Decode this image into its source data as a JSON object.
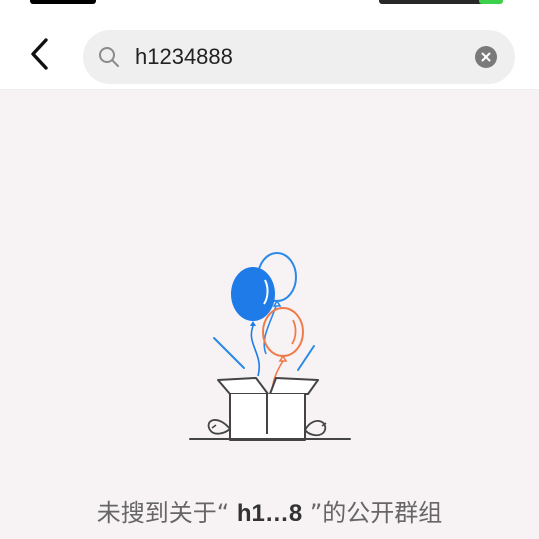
{
  "header": {
    "back_icon": "chevron-left-icon",
    "search": {
      "value": "h1234888",
      "placeholder": "",
      "search_icon": "search-icon",
      "clear_icon": "close-circle-icon"
    }
  },
  "empty_state": {
    "illustration": "balloons-gift-box-illustration",
    "message_prefix": "未搜到关于",
    "open_quote": "“",
    "keyword": "h1…8",
    "close_quote": "”",
    "message_suffix": "的公开群组"
  },
  "colors": {
    "background": "#f7f3f5",
    "blue_balloon": "#1e7be8",
    "orange_balloon": "#f07b4a",
    "outline": "#444444"
  }
}
